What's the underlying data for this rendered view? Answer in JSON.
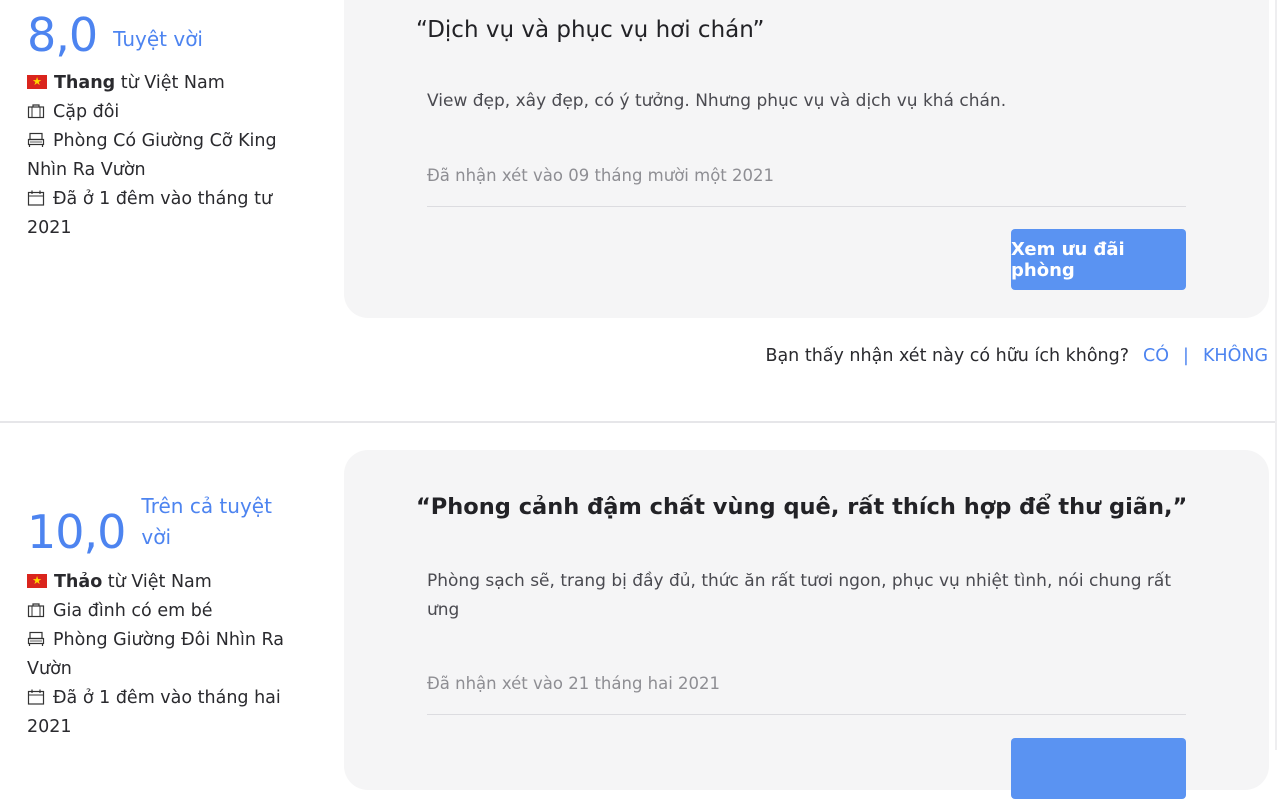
{
  "reviews": [
    {
      "score": "8,0",
      "score_label": "Tuyệt vời",
      "reviewer_name": "Thang",
      "reviewer_origin": " từ Việt Nam",
      "traveler_type": "Cặp đôi",
      "room_type": "Phòng Có Giường Cỡ King Nhìn Ra Vườn",
      "stay": "Đã ở 1 đêm vào tháng tư 2021",
      "title": "“Dịch vụ và phục vụ hơi chán”",
      "body": "View đẹp, xây đẹp, có ý tưởng. Nhưng phục vụ và dịch vụ khá chán.",
      "date": "Đã nhận xét vào 09 tháng mười một 2021",
      "button_label": "Xem ưu đãi phòng",
      "helpful_question": "Bạn thấy nhận xét này có hữu ích không?",
      "helpful_yes": "CÓ",
      "helpful_separator": "|",
      "helpful_no": "KHÔNG"
    },
    {
      "score": "10,0",
      "score_label": "Trên cả tuyệt vời",
      "reviewer_name": "Thảo",
      "reviewer_origin": " từ Việt Nam",
      "traveler_type": "Gia đình có em bé",
      "room_type": "Phòng Giường Đôi Nhìn Ra Vườn",
      "stay": "Đã ở 1 đêm vào tháng hai 2021",
      "title": "“Phong cảnh đậm chất vùng quê, rất thích hợp để thư giãn,”",
      "body": "Phòng sạch sẽ, trang bị đầy đủ, thức ăn rất tươi ngon, phục vụ nhiệt tình, nói chung rất ưng",
      "date": "Đã nhận xét vào 21 tháng hai 2021"
    }
  ],
  "icons": {
    "flag": "vietnam-flag-icon",
    "traveler": "briefcase-icon",
    "room": "bed-icon",
    "stay": "calendar-icon"
  },
  "colors": {
    "accent": "#4d84f0",
    "button": "#5a93f2",
    "card": "#f5f5f6"
  }
}
